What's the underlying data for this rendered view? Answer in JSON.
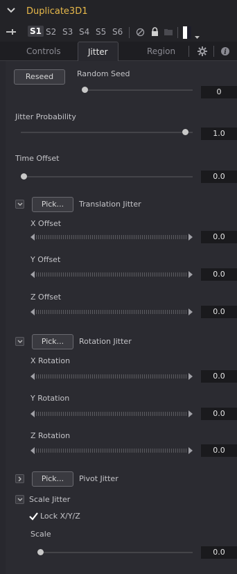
{
  "header": {
    "title": "Duplicate3D1"
  },
  "slots": [
    "S1",
    "S2",
    "S3",
    "S4",
    "S5",
    "S6"
  ],
  "tabs": {
    "controls": "Controls",
    "jitter": "Jitter",
    "region": "Region"
  },
  "random_seed": {
    "button": "Reseed",
    "label": "Random Seed",
    "value": "0",
    "level": 0.0
  },
  "jitter_probability": {
    "label": "Jitter Probability",
    "value": "1.0",
    "level": 1.0
  },
  "time_offset": {
    "label": "Time Offset",
    "value": "0.0",
    "level": 0.0
  },
  "translation": {
    "pick": "Pick...",
    "label": "Translation Jitter",
    "x": {
      "label": "X Offset",
      "value": "0.0"
    },
    "y": {
      "label": "Y Offset",
      "value": "0.0"
    },
    "z": {
      "label": "Z Offset",
      "value": "0.0"
    }
  },
  "rotation": {
    "pick": "Pick...",
    "label": "Rotation Jitter",
    "x": {
      "label": "X Rotation",
      "value": "0.0"
    },
    "y": {
      "label": "Y Rotation",
      "value": "0.0"
    },
    "z": {
      "label": "Z Rotation",
      "value": "0.0"
    }
  },
  "pivot": {
    "pick": "Pick...",
    "label": "Pivot Jitter"
  },
  "scale": {
    "label": "Scale Jitter",
    "lock_label": "Lock X/Y/Z",
    "lock_checked": true,
    "scale_label": "Scale",
    "scale_value": "0.0",
    "level": 0.0
  },
  "colors": {
    "title": "#e8b94a",
    "panel": "#28282e",
    "value_box": "#1a1a1d"
  }
}
